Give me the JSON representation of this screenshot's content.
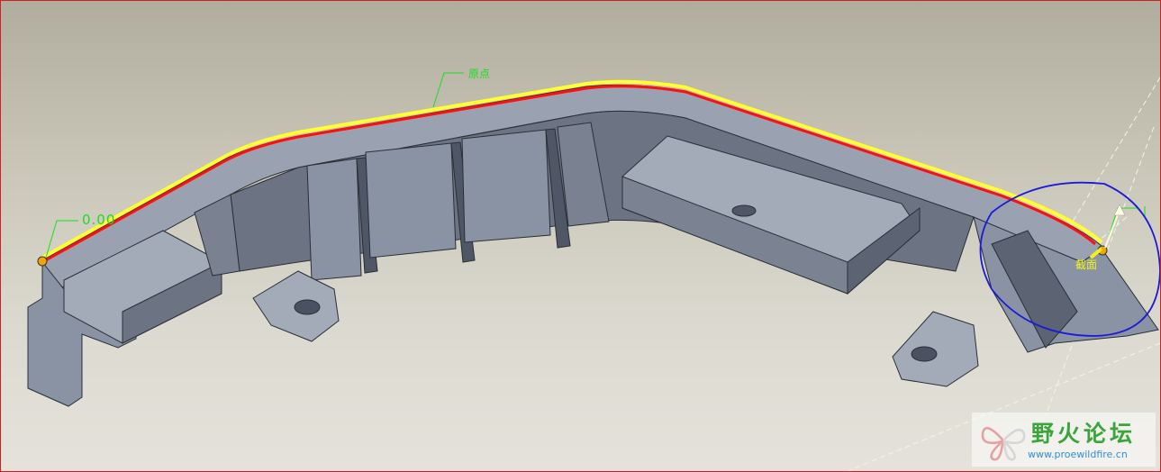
{
  "viewport": {
    "background_top": "#b0ad9f",
    "background_bottom": "#e4e2da",
    "border_color": "#d02020"
  },
  "annotations": {
    "origin_label": "原点",
    "dimension_label": "0.00",
    "section_label": "截面"
  },
  "colors": {
    "part_face": "#8a93a3",
    "part_dark": "#5e6676",
    "highlight_red": "#ff1010",
    "highlight_yellow": "#ffff33",
    "annotation_green": "#1fdc1f",
    "section_circle": "#1a1ad8",
    "point_marker": "#f2a400"
  },
  "watermark": {
    "title": "野火论坛",
    "url": "www.proewildfire.cn"
  }
}
